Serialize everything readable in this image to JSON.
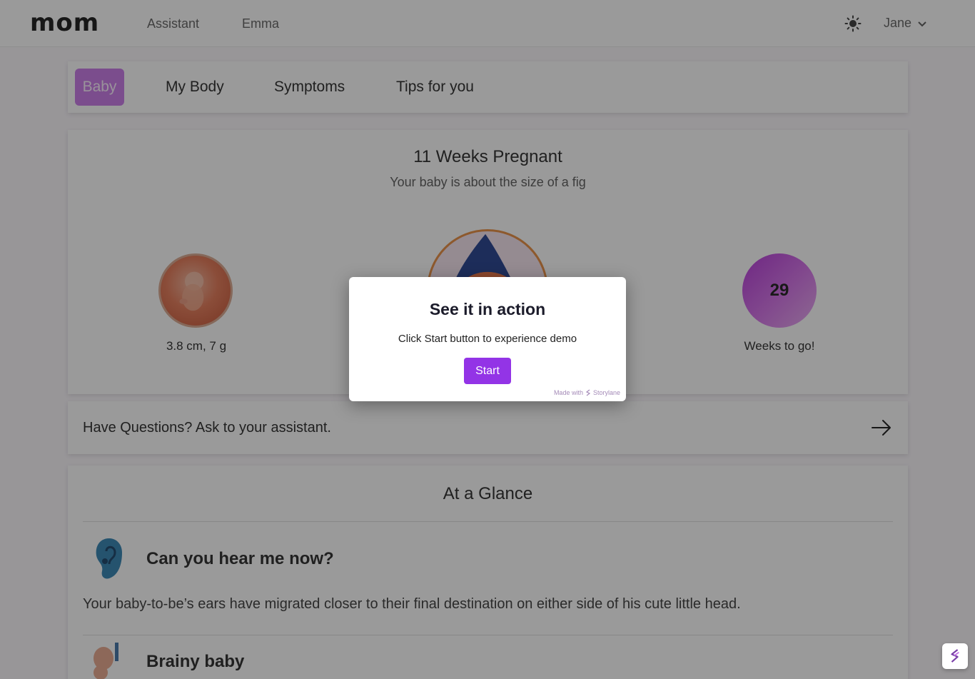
{
  "topnav": {
    "logo": "mom",
    "links": [
      "Assistant",
      "Emma"
    ],
    "user": "Jane",
    "theme_icon": "sun-icon"
  },
  "tabs": {
    "items": [
      "Baby",
      "My Body",
      "Symptoms",
      "Tips for you"
    ],
    "active": "Baby"
  },
  "weeks": {
    "title": "11 Weeks Pregnant",
    "subtitle": "Your baby is about the size of a fig",
    "baby_caption": "3.8 cm, 7 g",
    "weeks_to_go": "29",
    "weeks_caption": "Weeks to go!"
  },
  "ask": {
    "text": "Have Questions? Ask to your assistant.",
    "icon": "arrow-right-icon"
  },
  "glance": {
    "title": "At a Glance",
    "items": [
      {
        "icon": "ear-icon",
        "title": "Can you hear me now?",
        "text": "Your baby-to-be’s ears have migrated closer to their final destination on either side of his cute little head."
      },
      {
        "icon": "brain-icon",
        "title": "Brainy baby"
      }
    ]
  },
  "modal": {
    "title": "See it in action",
    "text": "Click Start button to experience demo",
    "button": "Start",
    "made_with": "Made with",
    "brand": "Storylane"
  },
  "colors": {
    "accent": "#9334e6",
    "tab_active": "#c674e8",
    "weeks_circle": "#b12dd6"
  }
}
